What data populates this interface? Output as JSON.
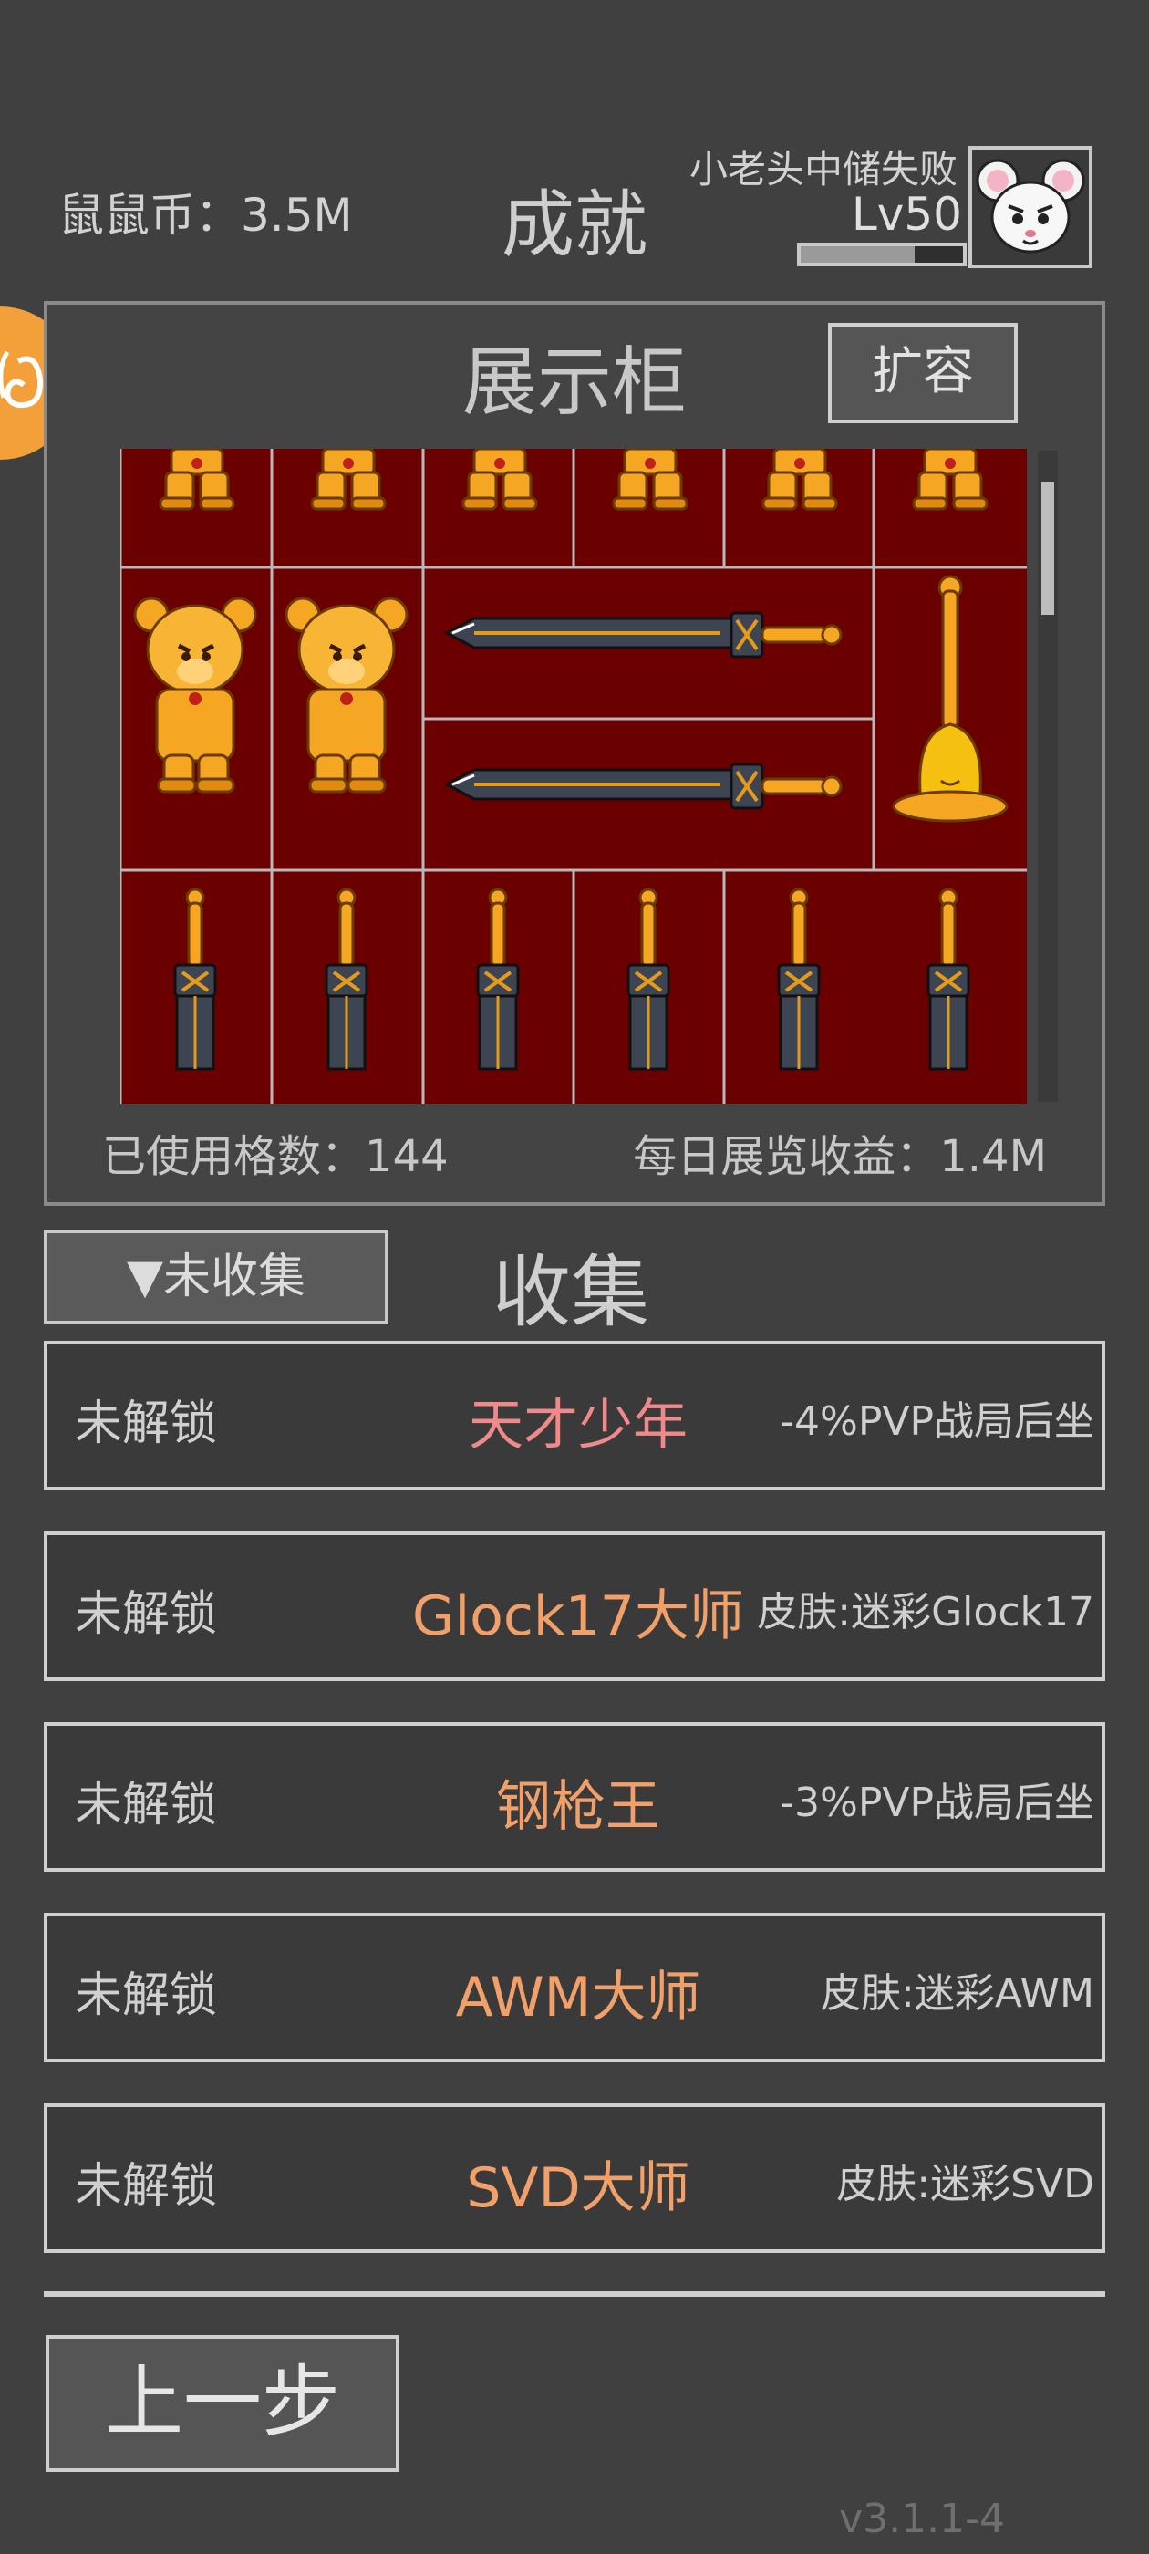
{
  "header": {
    "coins": "鼠鼠币：3.5M",
    "title": "成就",
    "player_name": "小老头中储失败",
    "level": "Lv50",
    "xp_progress": 0.7
  },
  "showcase": {
    "title": "展示柜",
    "expand_label": "扩容",
    "used_cells": "已使用格数：144",
    "daily_income": "每日展览收益：1.4M"
  },
  "collection": {
    "filter_label": "▼未收集",
    "title": "收集",
    "items": [
      {
        "status": "未解锁",
        "name": "天才少年",
        "reward": "-4%PVP战局后坐",
        "name_color": "#f08a8a"
      },
      {
        "status": "未解锁",
        "name": "Glock17大师",
        "reward": "皮肤:迷彩Glock17",
        "name_color": "#f2a06a"
      },
      {
        "status": "未解锁",
        "name": "钢枪王",
        "reward": "-3%PVP战局后坐",
        "name_color": "#f2a06a"
      },
      {
        "status": "未解锁",
        "name": "AWM大师",
        "reward": "皮肤:迷彩AWM",
        "name_color": "#f2a06a"
      },
      {
        "status": "未解锁",
        "name": "SVD大师",
        "reward": "皮肤:迷彩SVD",
        "name_color": "#f2a06a"
      }
    ]
  },
  "back_label": "上一步",
  "version": "v3.1.1-4",
  "colors": {
    "background": "#404040",
    "showcase_bg": "#6a0000",
    "gold": "#f5a623",
    "badge": "#f3a03a"
  }
}
